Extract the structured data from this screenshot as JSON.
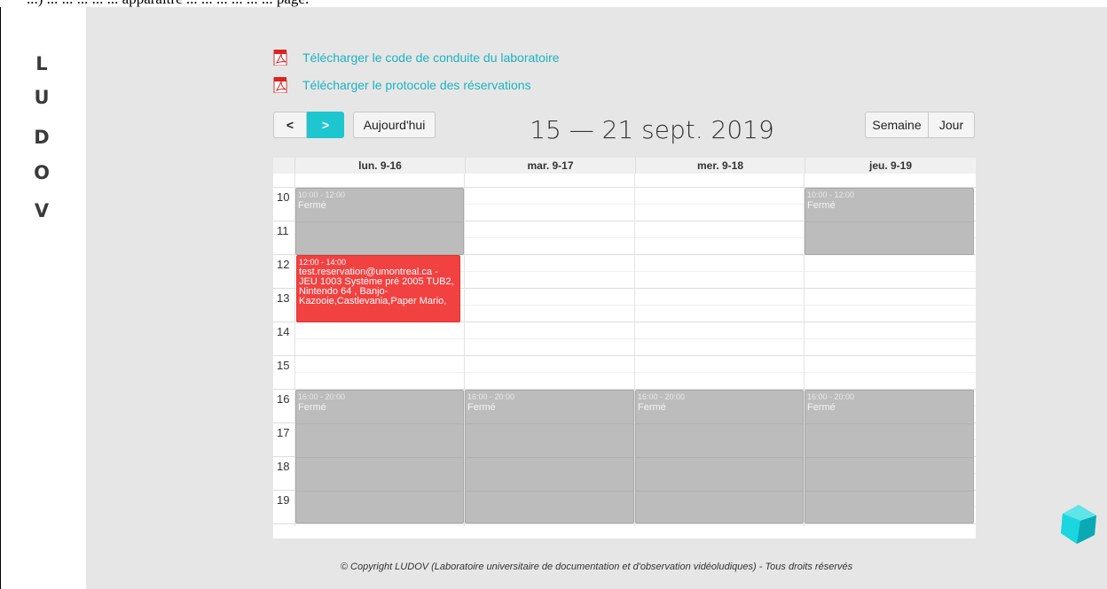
{
  "top_fragment": "...) ... ... ... ... ... apparaître ... ... ... ... ... ... page.",
  "brand": {
    "letters": [
      "L",
      "U",
      "D",
      "O",
      "V"
    ]
  },
  "links": [
    {
      "label": "Télécharger le code de conduite du laboratoire",
      "icon": "pdf-icon"
    },
    {
      "label": "Télécharger le protocole des réservations",
      "icon": "pdf-icon"
    }
  ],
  "toolbar": {
    "prev_label": "<",
    "next_label": ">",
    "today_label": "Aujourd'hui",
    "title": "15 — 21 sept. 2019",
    "week_label": "Semaine",
    "day_label": "Jour"
  },
  "calendar": {
    "columns": [
      "lun. 9-16",
      "mar. 9-17",
      "mer. 9-18",
      "jeu. 9-19"
    ],
    "hours": [
      "10",
      "11",
      "12",
      "13",
      "14",
      "15",
      "16",
      "17",
      "18",
      "19"
    ],
    "events": [
      {
        "time": "10:00 - 12:00",
        "title": "Fermé",
        "type": "closed"
      },
      {
        "time": "10:00 - 12:00",
        "title": "Fermé",
        "type": "closed"
      },
      {
        "time": "12:00 - 14:00",
        "title": "test.reservation@umontreal.ca - JEU 1003 Système pré 2005 TUB2, Nintendo 64 , Banjo-Kazooie,Castlevania,Paper Mario,",
        "type": "reserved"
      },
      {
        "time": "16:00 - 20:00",
        "title": "Fermé",
        "type": "closed"
      },
      {
        "time": "16:00 - 20:00",
        "title": "Fermé",
        "type": "closed"
      },
      {
        "time": "16:00 - 20:00",
        "title": "Fermé",
        "type": "closed"
      },
      {
        "time": "16:00 - 20:00",
        "title": "Fermé",
        "type": "closed"
      }
    ]
  },
  "footer": "© Copyright LUDOV (Laboratoire universitaire de documentation et d'observation vidéoludiques) - Tous droits réservés",
  "colors": {
    "accent": "#1ec6cf",
    "link": "#1cb3c1",
    "closed": "#bcbcbc",
    "reserved": "#f24141"
  }
}
